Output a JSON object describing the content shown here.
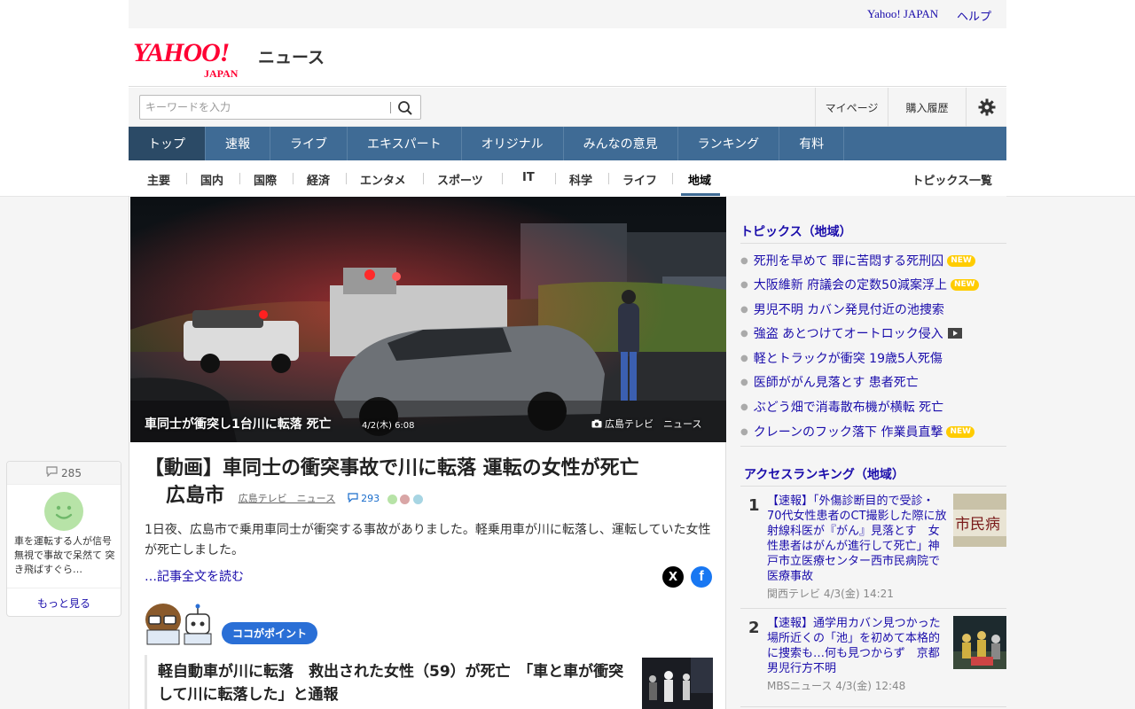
{
  "util": {
    "yahoo_japan": "Yahoo! JAPAN",
    "help": "ヘルプ"
  },
  "logo": {
    "yahoo": "YAHOO!",
    "japan": "JAPAN",
    "news": "ニュース"
  },
  "search": {
    "placeholder": "キーワードを入力"
  },
  "account": {
    "mypage": "マイページ",
    "history": "購入履歴"
  },
  "main_nav": [
    "トップ",
    "速報",
    "ライブ",
    "エキスパート",
    "オリジナル",
    "みんなの意見",
    "ランキング",
    "有料"
  ],
  "sub_nav": {
    "categories": [
      "主要",
      "国内",
      "国際",
      "経済",
      "エンタメ",
      "スポーツ",
      "IT",
      "科学",
      "ライフ",
      "地域"
    ],
    "active": "地域",
    "topics_list": "トピックス一覧"
  },
  "hero": {
    "caption": "車同士が衝突し1台川に転落 死亡",
    "date": "4/2(木) 6:08",
    "source": "広島テレビ　ニュース"
  },
  "article": {
    "title_line1": "【動画】車同士の衝突事故で川に転落 運転の女性が死亡",
    "title_line2": "広島市",
    "source": "広島テレビ　ニュース",
    "comment_count": "293",
    "summary": "1日夜、広島市で乗用車同士が衝突する事故がありました。軽乗用車が川に転落し、運転していた女性が死亡しました。",
    "readmore": "…記事全文を読む",
    "share_x": "X",
    "share_fb": "f",
    "point_label": "ココがポイント",
    "related_title": "軽自動車が川に転落　救出された女性（59）が死亡　「車と車が衝突して川に転落した」と通報"
  },
  "topics": {
    "title": "トピックス（地域）",
    "items": [
      {
        "text": "死刑を早めて 罪に苦悶する死刑囚",
        "badge": "NEW"
      },
      {
        "text": "大阪維新 府議会の定数50減案浮上",
        "badge": "NEW"
      },
      {
        "text": "男児不明 カバン発見付近の池捜索",
        "badge": ""
      },
      {
        "text": "強盗 あとつけてオートロック侵入",
        "badge": "video"
      },
      {
        "text": "軽とトラックが衝突 19歳5人死傷",
        "badge": ""
      },
      {
        "text": "医師ががん見落とす 患者死亡",
        "badge": ""
      },
      {
        "text": "ぶどう畑で消毒散布機が横転 死亡",
        "badge": ""
      },
      {
        "text": "クレーンのフック落下 作業員直撃",
        "badge": "NEW"
      }
    ],
    "new_label": "NEW"
  },
  "ranking": {
    "title": "アクセスランキング（地域）",
    "items": [
      {
        "rank": "1",
        "text": "【速報】「外傷診断目的で受診・70代女性患者のCT撮影した際に放射線科医が『がん』見落とす　女性患者はがんが進行して死亡」神戸市立医療センター西市民病院で医療事故",
        "source": "関西テレビ",
        "date": "4/3(金) 14:21",
        "thumb_text": "市民病"
      },
      {
        "rank": "2",
        "text": "【速報】通学用カバン見つかった場所近くの「池」を初めて本格的に捜索も…何も見つからず　京都男児行方不明",
        "source": "MBSニュース",
        "date": "4/3(金) 12:48"
      }
    ]
  },
  "comment_widget": {
    "count": "285",
    "text": "車を運転する人が信号無視で事故で呆然て 突き飛ばすぐら…",
    "more": "もっと見る"
  },
  "colors": {
    "nav_bg": "#3f6b95",
    "nav_active": "#2b4a66",
    "link": "#1a0dab",
    "brand": "#ff0033",
    "new_badge": "#ffcc00"
  }
}
